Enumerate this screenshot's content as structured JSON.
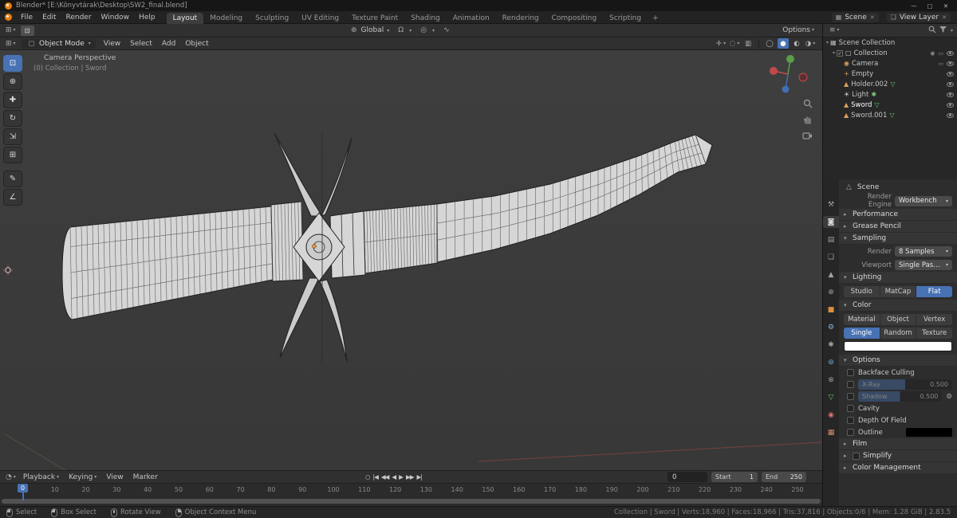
{
  "title_bar": {
    "title": "Blender* [E:\\Könyvtárak\\Desktop\\SW2_final.blend]",
    "controls": {
      "min": "—",
      "max": "▢",
      "close": "✕"
    }
  },
  "menu_bar": {
    "menus": [
      "File",
      "Edit",
      "Render",
      "Window",
      "Help"
    ],
    "workspaces": [
      "Layout",
      "Modeling",
      "Sculpting",
      "UV Editing",
      "Texture Paint",
      "Shading",
      "Animation",
      "Rendering",
      "Compositing",
      "Scripting"
    ],
    "add_tab": "+",
    "scene_label": "Scene",
    "view_layer_label": "View Layer"
  },
  "icons": {
    "tool_settings_editor": "⊞",
    "active_tool": "⊡",
    "globe": "⊕",
    "magnet": "Ω",
    "proportional": "◎",
    "falloff": "∿",
    "viewport_editor": "⊞",
    "object_mode": "◻",
    "outliner_editor": "≡",
    "clock": "◔",
    "scene_small": "▦",
    "viewlayer_small": "❏",
    "unlink": "✕",
    "scene_breadcrumb": "△",
    "gear": "⚙",
    "record": "○"
  },
  "tool_settings": {
    "orientation_label": "Global",
    "options_label": "Options"
  },
  "viewport_header": {
    "mode_label": "Object Mode",
    "menus": [
      "View",
      "Select",
      "Add",
      "Object"
    ],
    "icons": {
      "gizmo": "✛",
      "overlays": "◌",
      "xray": "▥"
    },
    "shading": [
      "◯",
      "●",
      "◐",
      "◑"
    ]
  },
  "viewport": {
    "view_label": "Camera Perspective",
    "context_label": "(0) Collection | Sword"
  },
  "left_toolbar": {
    "tools": [
      {
        "name": "select-box",
        "glyph": "⊡"
      },
      {
        "name": "cursor",
        "glyph": "⊕"
      },
      {
        "name": "move",
        "glyph": "✚"
      },
      {
        "name": "rotate",
        "glyph": "↻"
      },
      {
        "name": "scale",
        "glyph": "⇲"
      },
      {
        "name": "transform",
        "glyph": "⊞"
      },
      {
        "name": "annotate",
        "glyph": "✎"
      },
      {
        "name": "measure",
        "glyph": "∠"
      }
    ]
  },
  "outliner": {
    "items": [
      {
        "label": "Scene Collection"
      },
      {
        "label": "Collection"
      },
      {
        "label": "Camera"
      },
      {
        "label": "Empty"
      },
      {
        "label": "Holder.002"
      },
      {
        "label": "Light"
      },
      {
        "label": "Sword"
      },
      {
        "label": "Sword.001"
      }
    ]
  },
  "properties": {
    "active_tab_index": 1,
    "tabs": [
      {
        "name": "tool-tab",
        "glyph": "⚒",
        "color": "#a0a0a0"
      },
      {
        "name": "render-tab",
        "glyph": "◙",
        "color": "#d8d8d8"
      },
      {
        "name": "output-tab",
        "glyph": "▤",
        "color": "#a0a0a0"
      },
      {
        "name": "view-layer-tab",
        "glyph": "❏",
        "color": "#a0a0a0"
      },
      {
        "name": "scene-tab",
        "glyph": "▲",
        "color": "#a0a0a0"
      },
      {
        "name": "world-tab",
        "glyph": "⊕",
        "color": "#a0a0a0"
      },
      {
        "name": "object-tab",
        "glyph": "■",
        "color": "#dd8d3e"
      },
      {
        "name": "modifiers-tab",
        "glyph": "⚙",
        "color": "#8fb7dd"
      },
      {
        "name": "particles-tab",
        "glyph": "✱",
        "color": "#a0a0a0"
      },
      {
        "name": "physics-tab",
        "glyph": "⊚",
        "color": "#6fb3e0"
      },
      {
        "name": "constraints-tab",
        "glyph": "⊗",
        "color": "#a0a0a0"
      },
      {
        "name": "object-data-tab",
        "glyph": "▽",
        "color": "#6fc36f"
      },
      {
        "name": "material-tab",
        "glyph": "◉",
        "color": "#d87070"
      },
      {
        "name": "texture-tab",
        "glyph": "▦",
        "color": "#d88d70"
      }
    ],
    "breadcrumb": "Scene",
    "render_engine_label": "Render Engine",
    "render_engine_value": "Workbench",
    "sections": {
      "performance": "Performance",
      "grease_pencil": "Grease Pencil",
      "sampling": "Sampling",
      "lighting": "Lighting",
      "color": "Color",
      "options": "Options",
      "film": "Film",
      "simplify": "Simplify",
      "color_management": "Color Management"
    },
    "sampling": {
      "render_label": "Render",
      "render_value": "8 Samples",
      "viewport_label": "Viewport",
      "viewport_value": "Single Pass Anti-A..."
    },
    "lighting": {
      "options": [
        "Studio",
        "MatCap",
        "Flat"
      ],
      "active": "Flat"
    },
    "color": {
      "row1": [
        "Material",
        "Object",
        "Vertex"
      ],
      "row2": [
        "Single",
        "Random",
        "Texture"
      ],
      "active": "Single",
      "swatch": "#ffffff"
    },
    "options": {
      "backface": "Backface Culling",
      "xray_label": "X-Ray",
      "xray_value": "0.500",
      "shadow_label": "Shadow",
      "shadow_value": "0.500",
      "cavity": "Cavity",
      "dof": "Depth Of Field",
      "outline": "Outline",
      "outline_swatch": "#000000"
    }
  },
  "timeline": {
    "menus": [
      "Playback",
      "Keying",
      "View",
      "Marker"
    ],
    "transport": [
      "○",
      "|◀",
      "◀◀",
      "◀",
      "▶",
      "▶▶",
      "▶|"
    ],
    "current_frame": "0",
    "start_label": "Start",
    "start_value": "1",
    "end_label": "End",
    "end_value": "250"
  },
  "ruler": {
    "ticks": [
      "0",
      "10",
      "20",
      "30",
      "40",
      "50",
      "60",
      "70",
      "80",
      "90",
      "100",
      "110",
      "120",
      "130",
      "140",
      "150",
      "160",
      "170",
      "180",
      "190",
      "200",
      "210",
      "220",
      "230",
      "240",
      "250"
    ],
    "playhead": "0"
  },
  "status_bar": {
    "items": [
      {
        "label": "Select"
      },
      {
        "label": "Box Select"
      },
      {
        "label": "Rotate View"
      },
      {
        "label": "Object Context Menu"
      }
    ],
    "stats": "Collection | Sword | Verts:18,960 | Faces:18,966 | Tris:37,816 | Objects:0/6 | Mem: 1.28 GiB | 2.83.5"
  }
}
